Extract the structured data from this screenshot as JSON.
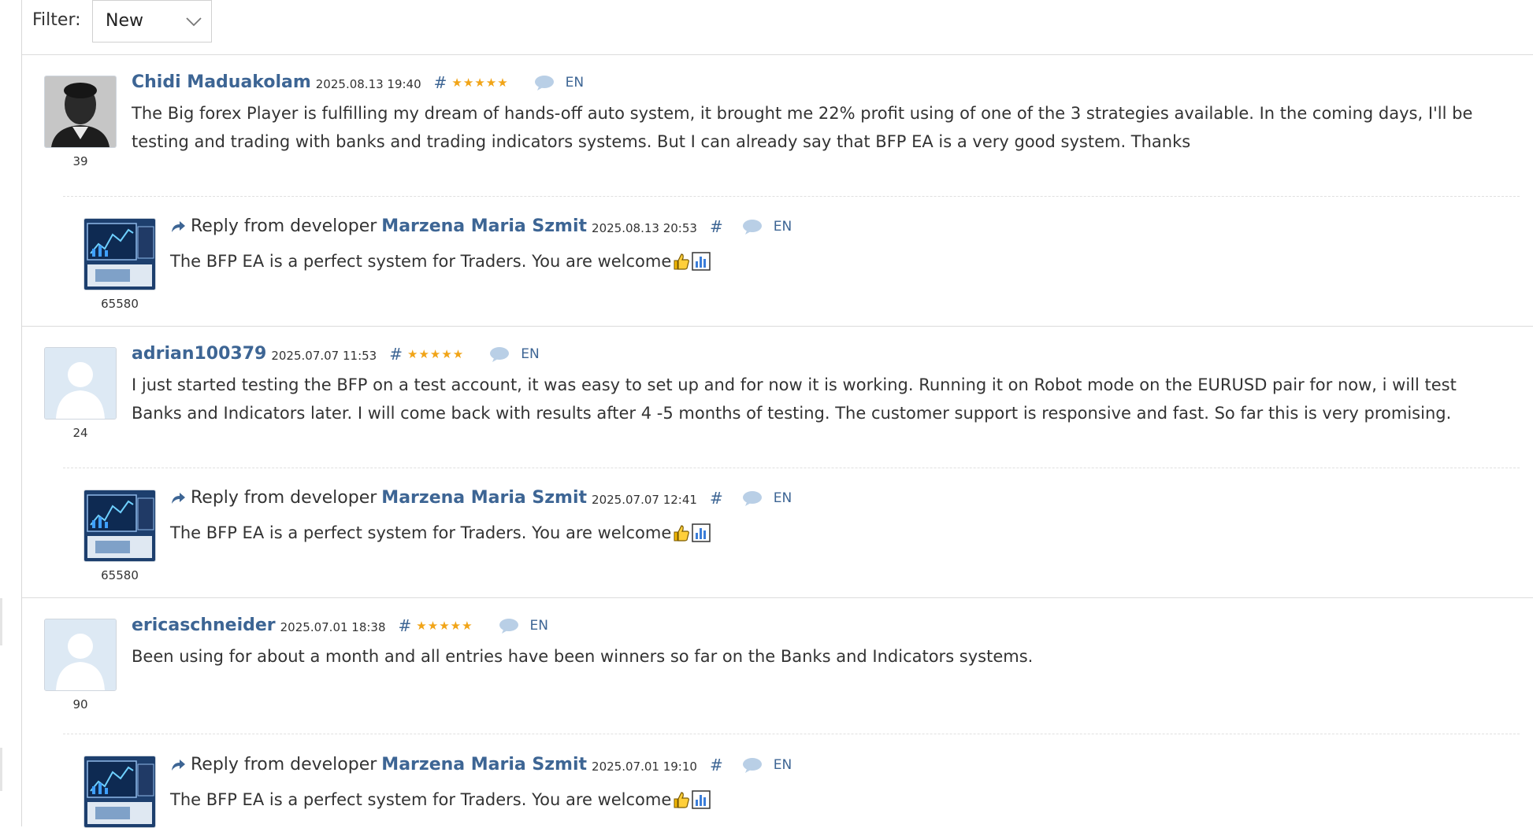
{
  "filter": {
    "label": "Filter:",
    "value": "New"
  },
  "icons": {
    "chevron": "chevron-down-icon",
    "comment": "speech-bubble-icon",
    "reply": "reply-arrow-icon"
  },
  "colors": {
    "link": "#3d6594",
    "stars": "#f1a417",
    "text": "#333333"
  },
  "reviews": [
    {
      "author": "Chidi Maduakolam",
      "date": "2025.08.13 19:40",
      "hash": "#",
      "stars": "★★★★★",
      "rating": 5,
      "lang": "EN",
      "count": "39",
      "text": "The Big forex Player is fulfilling my dream of hands-off auto system, it brought me 22% profit using of one of the 3 strategies available. In the coming days, I'll be testing and trading with banks and trading indicators systems. But I can already say that BFP EA is a very good system. Thanks",
      "reply": {
        "label": "Reply from developer",
        "author": "Marzena Maria Szmit",
        "date": "2025.08.13 20:53",
        "hash": "#",
        "lang": "EN",
        "count": "65580",
        "text": "The BFP EA is a perfect system for Traders. You are welcome"
      }
    },
    {
      "author": "adrian100379",
      "date": "2025.07.07 11:53",
      "hash": "#",
      "stars": "★★★★★",
      "rating": 5,
      "lang": "EN",
      "count": "24",
      "text": "I just started testing the BFP on a test account, it was easy to set up and for now it is working. Running it on Robot mode on the EURUSD pair for now, i will test Banks and Indicators later. I will come back with results after 4 -5 months of testing. The customer support is responsive and fast. So far this is very promising.",
      "reply": {
        "label": "Reply from developer",
        "author": "Marzena Maria Szmit",
        "date": "2025.07.07 12:41",
        "hash": "#",
        "lang": "EN",
        "count": "65580",
        "text": "The BFP EA is a perfect system for Traders. You are welcome"
      }
    },
    {
      "author": "ericaschneider",
      "date": "2025.07.01 18:38",
      "hash": "#",
      "stars": "★★★★★",
      "rating": 5,
      "lang": "EN",
      "count": "90",
      "text": "Been using for about a month and all entries have been winners so far on the Banks and Indicators systems.",
      "reply": {
        "label": "Reply from developer",
        "author": "Marzena Maria Szmit",
        "date": "2025.07.01 19:10",
        "hash": "#",
        "lang": "EN",
        "count": "",
        "text": "The BFP EA is a perfect system for Traders. You are welcome"
      }
    }
  ]
}
